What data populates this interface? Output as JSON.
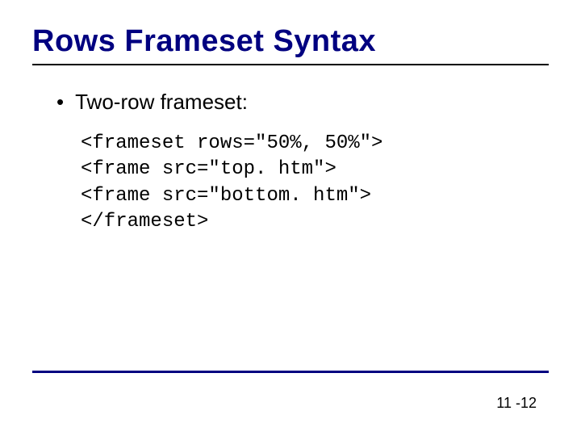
{
  "title": "Rows Frameset Syntax",
  "bullet": {
    "text": "Two-row frameset:"
  },
  "code": {
    "line1": "<frameset rows=\"50%, 50%\">",
    "line2": "<frame src=\"top. htm\">",
    "line3": "<frame src=\"bottom. htm\">",
    "line4": "</frameset>"
  },
  "page_number": "11 -12"
}
